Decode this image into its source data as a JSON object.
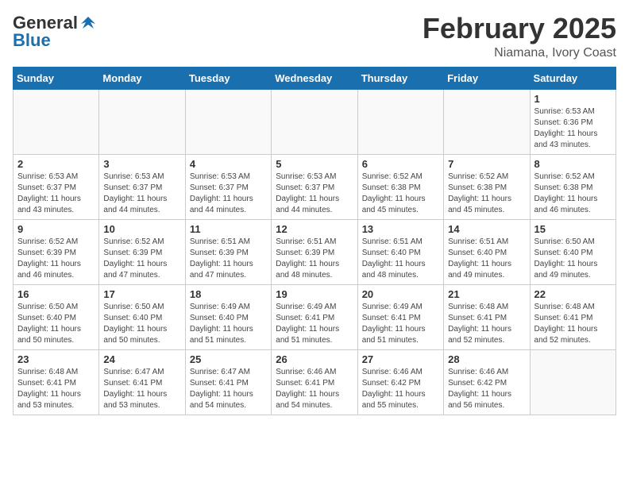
{
  "header": {
    "logo_general": "General",
    "logo_blue": "Blue",
    "month_title": "February 2025",
    "location": "Niamana, Ivory Coast"
  },
  "days_of_week": [
    "Sunday",
    "Monday",
    "Tuesday",
    "Wednesday",
    "Thursday",
    "Friday",
    "Saturday"
  ],
  "weeks": [
    [
      {
        "day": "",
        "info": ""
      },
      {
        "day": "",
        "info": ""
      },
      {
        "day": "",
        "info": ""
      },
      {
        "day": "",
        "info": ""
      },
      {
        "day": "",
        "info": ""
      },
      {
        "day": "",
        "info": ""
      },
      {
        "day": "1",
        "info": "Sunrise: 6:53 AM\nSunset: 6:36 PM\nDaylight: 11 hours\nand 43 minutes."
      }
    ],
    [
      {
        "day": "2",
        "info": "Sunrise: 6:53 AM\nSunset: 6:37 PM\nDaylight: 11 hours\nand 43 minutes."
      },
      {
        "day": "3",
        "info": "Sunrise: 6:53 AM\nSunset: 6:37 PM\nDaylight: 11 hours\nand 44 minutes."
      },
      {
        "day": "4",
        "info": "Sunrise: 6:53 AM\nSunset: 6:37 PM\nDaylight: 11 hours\nand 44 minutes."
      },
      {
        "day": "5",
        "info": "Sunrise: 6:53 AM\nSunset: 6:37 PM\nDaylight: 11 hours\nand 44 minutes."
      },
      {
        "day": "6",
        "info": "Sunrise: 6:52 AM\nSunset: 6:38 PM\nDaylight: 11 hours\nand 45 minutes."
      },
      {
        "day": "7",
        "info": "Sunrise: 6:52 AM\nSunset: 6:38 PM\nDaylight: 11 hours\nand 45 minutes."
      },
      {
        "day": "8",
        "info": "Sunrise: 6:52 AM\nSunset: 6:38 PM\nDaylight: 11 hours\nand 46 minutes."
      }
    ],
    [
      {
        "day": "9",
        "info": "Sunrise: 6:52 AM\nSunset: 6:39 PM\nDaylight: 11 hours\nand 46 minutes."
      },
      {
        "day": "10",
        "info": "Sunrise: 6:52 AM\nSunset: 6:39 PM\nDaylight: 11 hours\nand 47 minutes."
      },
      {
        "day": "11",
        "info": "Sunrise: 6:51 AM\nSunset: 6:39 PM\nDaylight: 11 hours\nand 47 minutes."
      },
      {
        "day": "12",
        "info": "Sunrise: 6:51 AM\nSunset: 6:39 PM\nDaylight: 11 hours\nand 48 minutes."
      },
      {
        "day": "13",
        "info": "Sunrise: 6:51 AM\nSunset: 6:40 PM\nDaylight: 11 hours\nand 48 minutes."
      },
      {
        "day": "14",
        "info": "Sunrise: 6:51 AM\nSunset: 6:40 PM\nDaylight: 11 hours\nand 49 minutes."
      },
      {
        "day": "15",
        "info": "Sunrise: 6:50 AM\nSunset: 6:40 PM\nDaylight: 11 hours\nand 49 minutes."
      }
    ],
    [
      {
        "day": "16",
        "info": "Sunrise: 6:50 AM\nSunset: 6:40 PM\nDaylight: 11 hours\nand 50 minutes."
      },
      {
        "day": "17",
        "info": "Sunrise: 6:50 AM\nSunset: 6:40 PM\nDaylight: 11 hours\nand 50 minutes."
      },
      {
        "day": "18",
        "info": "Sunrise: 6:49 AM\nSunset: 6:40 PM\nDaylight: 11 hours\nand 51 minutes."
      },
      {
        "day": "19",
        "info": "Sunrise: 6:49 AM\nSunset: 6:41 PM\nDaylight: 11 hours\nand 51 minutes."
      },
      {
        "day": "20",
        "info": "Sunrise: 6:49 AM\nSunset: 6:41 PM\nDaylight: 11 hours\nand 51 minutes."
      },
      {
        "day": "21",
        "info": "Sunrise: 6:48 AM\nSunset: 6:41 PM\nDaylight: 11 hours\nand 52 minutes."
      },
      {
        "day": "22",
        "info": "Sunrise: 6:48 AM\nSunset: 6:41 PM\nDaylight: 11 hours\nand 52 minutes."
      }
    ],
    [
      {
        "day": "23",
        "info": "Sunrise: 6:48 AM\nSunset: 6:41 PM\nDaylight: 11 hours\nand 53 minutes."
      },
      {
        "day": "24",
        "info": "Sunrise: 6:47 AM\nSunset: 6:41 PM\nDaylight: 11 hours\nand 53 minutes."
      },
      {
        "day": "25",
        "info": "Sunrise: 6:47 AM\nSunset: 6:41 PM\nDaylight: 11 hours\nand 54 minutes."
      },
      {
        "day": "26",
        "info": "Sunrise: 6:46 AM\nSunset: 6:41 PM\nDaylight: 11 hours\nand 54 minutes."
      },
      {
        "day": "27",
        "info": "Sunrise: 6:46 AM\nSunset: 6:42 PM\nDaylight: 11 hours\nand 55 minutes."
      },
      {
        "day": "28",
        "info": "Sunrise: 6:46 AM\nSunset: 6:42 PM\nDaylight: 11 hours\nand 56 minutes."
      },
      {
        "day": "",
        "info": ""
      }
    ]
  ]
}
